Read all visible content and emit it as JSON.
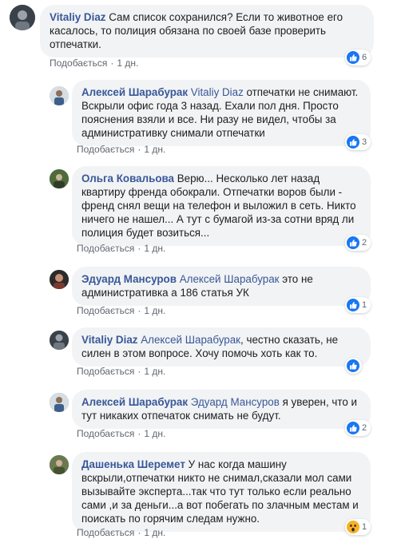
{
  "ui": {
    "like_label": "Подобається",
    "separator": "·"
  },
  "comments": [
    {
      "author": "Vitaliy Diaz",
      "mention": "",
      "text": "Сам список сохранился? Если то животное его касалось, то полиция обязана по своей базе проверить отпечатки.",
      "time": "1 дн.",
      "reaction": "like",
      "reaction_count": "6"
    },
    {
      "author": "Алексей Шарабурак",
      "mention": "Vitaliy Diaz",
      "text": "отпечатки не снимают. Вскрыли офис года 3 назад. Ехали пол дня. Просто пояснения взяли и все. Ни разу не видел, чтобы за административку снимали отпечатки",
      "time": "1 дн.",
      "reaction": "like",
      "reaction_count": "3"
    },
    {
      "author": "Ольга Ковальова",
      "mention": "",
      "text": "Верю... Несколько лет назад квартиру френда обокрали. Отпечатки воров были - френд снял вещи на телефон и выложил в сеть. Никто ничего не нашел... А тут с бумагой из-за сотни вряд ли полиция будет возиться...",
      "time": "1 дн.",
      "reaction": "like",
      "reaction_count": "2"
    },
    {
      "author": "Эдуард Мансуров",
      "mention": "Алексей Шарабурак",
      "text": "это не административка а 186 статья УК",
      "time": "1 дн.",
      "reaction": "like",
      "reaction_count": "1"
    },
    {
      "author": "Vitaliy Diaz",
      "mention": "Алексей Шарабурак",
      "text": ", честно сказать, не силен в этом вопросе. Хочу помочь хоть как то.",
      "time": "1 дн.",
      "reaction": "like",
      "reaction_count": ""
    },
    {
      "author": "Алексей Шарабурак",
      "mention": "Эдуард Мансуров",
      "text": "я уверен, что и тут никаких отпечаток снимать не будут.",
      "time": "1 дн.",
      "reaction": "like",
      "reaction_count": "2"
    },
    {
      "author": "Дашенька Шеремет",
      "mention": "",
      "text": "У нас когда машину вскрыли,отпечатки никто не снимал,сказали мол сами вызывайте эксперта...так что тут только если реально сами ,и за деньги...а вот побегать по злачным местам и поискать по горячим следам нужно.",
      "time": "1 дн.",
      "reaction": "wow",
      "reaction_count": "1"
    }
  ]
}
